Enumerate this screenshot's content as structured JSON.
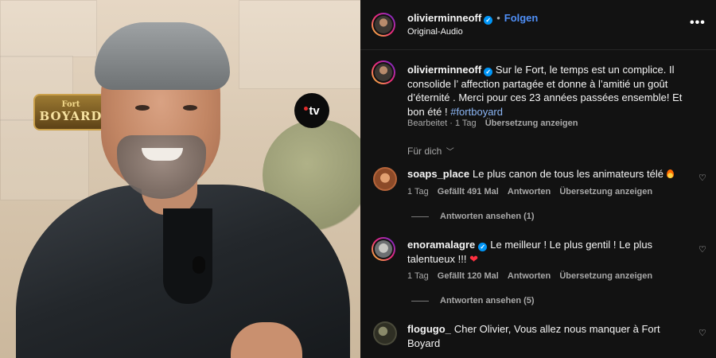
{
  "media": {
    "logo_fort_top": "Fort",
    "logo_fort_bottom": "BOYARD",
    "logo_tv": "tv"
  },
  "header": {
    "username": "olivierminneoff",
    "follow_label": "Folgen",
    "subtitle": "Original-Audio",
    "more_label": "•••"
  },
  "caption": {
    "username": "olivierminneoff",
    "text": "Sur le Fort, le temps est un complice. Il consolide l’ affection partagée et donne à l’amitié un goût d’éternité . Merci pour ces 23 années passées ensemble! Et bon été ! ",
    "hashtag": "#fortboyard",
    "edited": "Bearbeitet",
    "time": "1 Tag",
    "translate": "Übersetzung anzeigen"
  },
  "sort_label": "Für dich",
  "comments": [
    {
      "username": "soaps_place",
      "text": "Le plus canon de tous les animateurs télé",
      "time": "1 Tag",
      "likes": "Gefällt 491 Mal",
      "reply": "Antworten",
      "translate": "Übersetzung anzeigen",
      "view_replies": "Antworten ansehen (1)",
      "avatar_color": "#b5643a"
    },
    {
      "username": "enoramalagre",
      "text": "Le meilleur ! Le plus gentil ! Le plus talentueux !!!",
      "time": "1 Tag",
      "likes": "Gefällt 120 Mal",
      "reply": "Antworten",
      "translate": "Übersetzung anzeigen",
      "view_replies": "Antworten ansehen (5)",
      "avatar_color": "#8d8f90"
    },
    {
      "username": "flogugo_",
      "text": "Cher Olivier, Vous allez nous manquer à Fort Boyard",
      "avatar_color": "#4a4a3a"
    }
  ],
  "colors": {
    "background": "#121212",
    "accent_blue": "#4f8ff7",
    "verified_blue": "#0095f6",
    "muted_text": "#a8a8a8"
  }
}
